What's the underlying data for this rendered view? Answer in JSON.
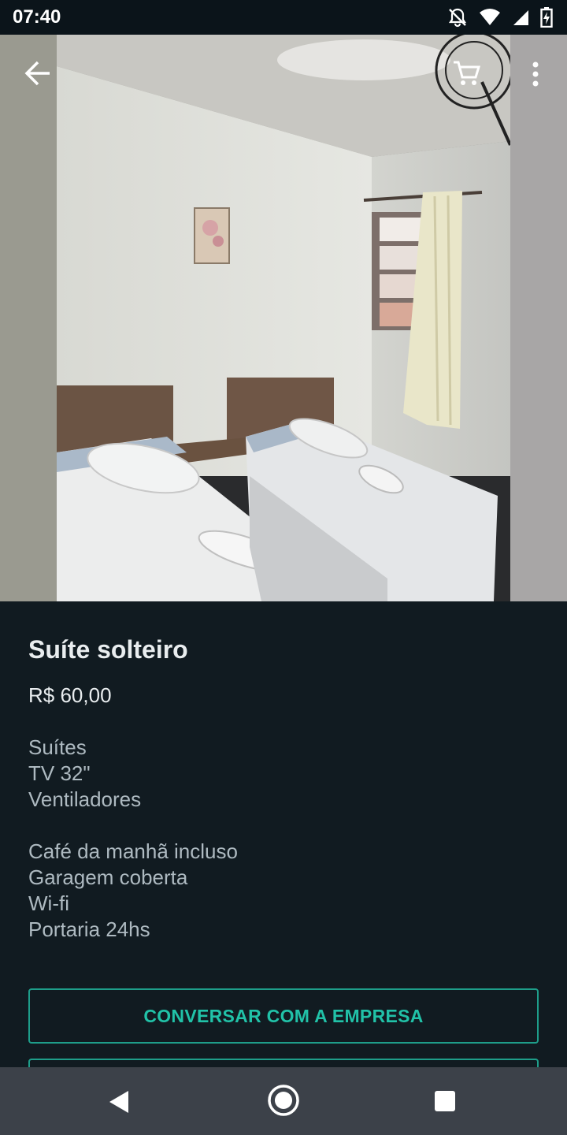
{
  "status_bar": {
    "time": "07:40",
    "icons": [
      "bell-off-icon",
      "wifi-icon",
      "signal-icon",
      "battery-charging-icon"
    ]
  },
  "toolbar": {
    "back_icon": "arrow-left-icon",
    "cart_icon": "shopping-cart-icon",
    "menu_icon": "more-vertical-icon"
  },
  "product": {
    "title": "Suíte solteiro",
    "price": "R$ 60,00",
    "description_group_1": [
      "Suítes",
      "TV 32\"",
      "Ventiladores"
    ],
    "description_group_2": [
      "Café da manhã incluso",
      "Garagem coberta",
      "Wi-fi",
      "Portaria 24hs"
    ]
  },
  "actions": {
    "chat_label": "CONVERSAR COM A EMPRESA",
    "second_label": ""
  },
  "colors": {
    "background": "#111b21",
    "accent": "#21c2a8",
    "nav_bar": "#3c4149"
  }
}
